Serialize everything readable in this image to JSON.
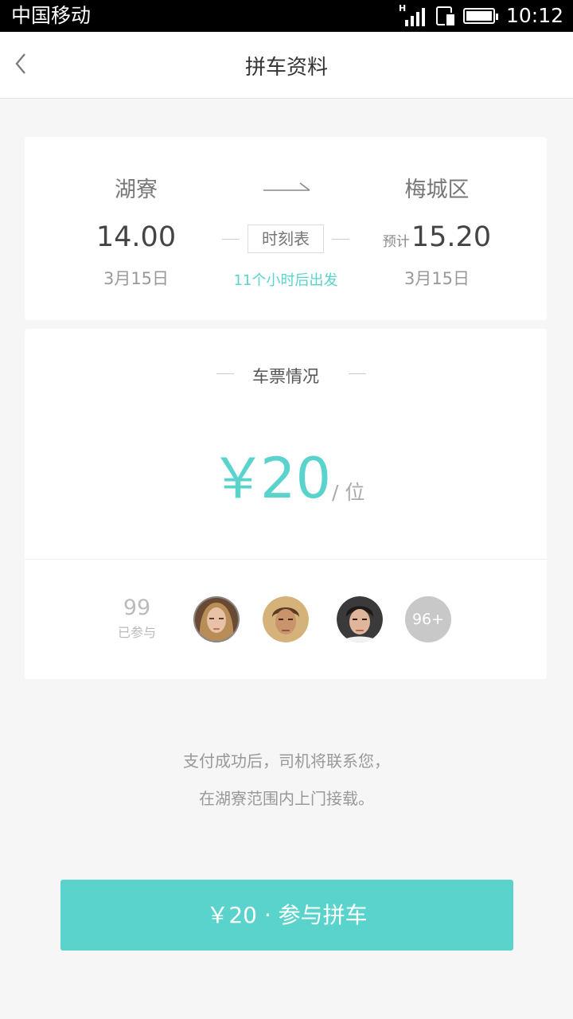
{
  "status_bar": {
    "carrier": "中国移动",
    "network": "H",
    "time": "10:12"
  },
  "nav": {
    "title": "拼车资料"
  },
  "route": {
    "from_city": "湖寮",
    "from_time": "14.00",
    "from_date": "3月15日",
    "to_city": "梅城区",
    "est_label": "预计",
    "to_time": "15.20",
    "to_date": "3月15日",
    "timetable_label": "时刻表",
    "depart_note": "11个小时后出发"
  },
  "ticket": {
    "heading": "车票情况",
    "currency": "￥",
    "price": "20",
    "unit": "/ 位",
    "joined_count": "99",
    "joined_label": "已参与",
    "more_label": "96+",
    "avatars": [
      "avatar-woman",
      "avatar-man-1",
      "avatar-man-2"
    ]
  },
  "note": {
    "line1": "支付成功后，司机将联系您，",
    "line2": "在湖寮范围内上门接载。"
  },
  "join_button": {
    "label": "￥20 · 参与拼车"
  },
  "colors": {
    "accent": "#5ad3cc",
    "background": "#f6f6f6"
  }
}
